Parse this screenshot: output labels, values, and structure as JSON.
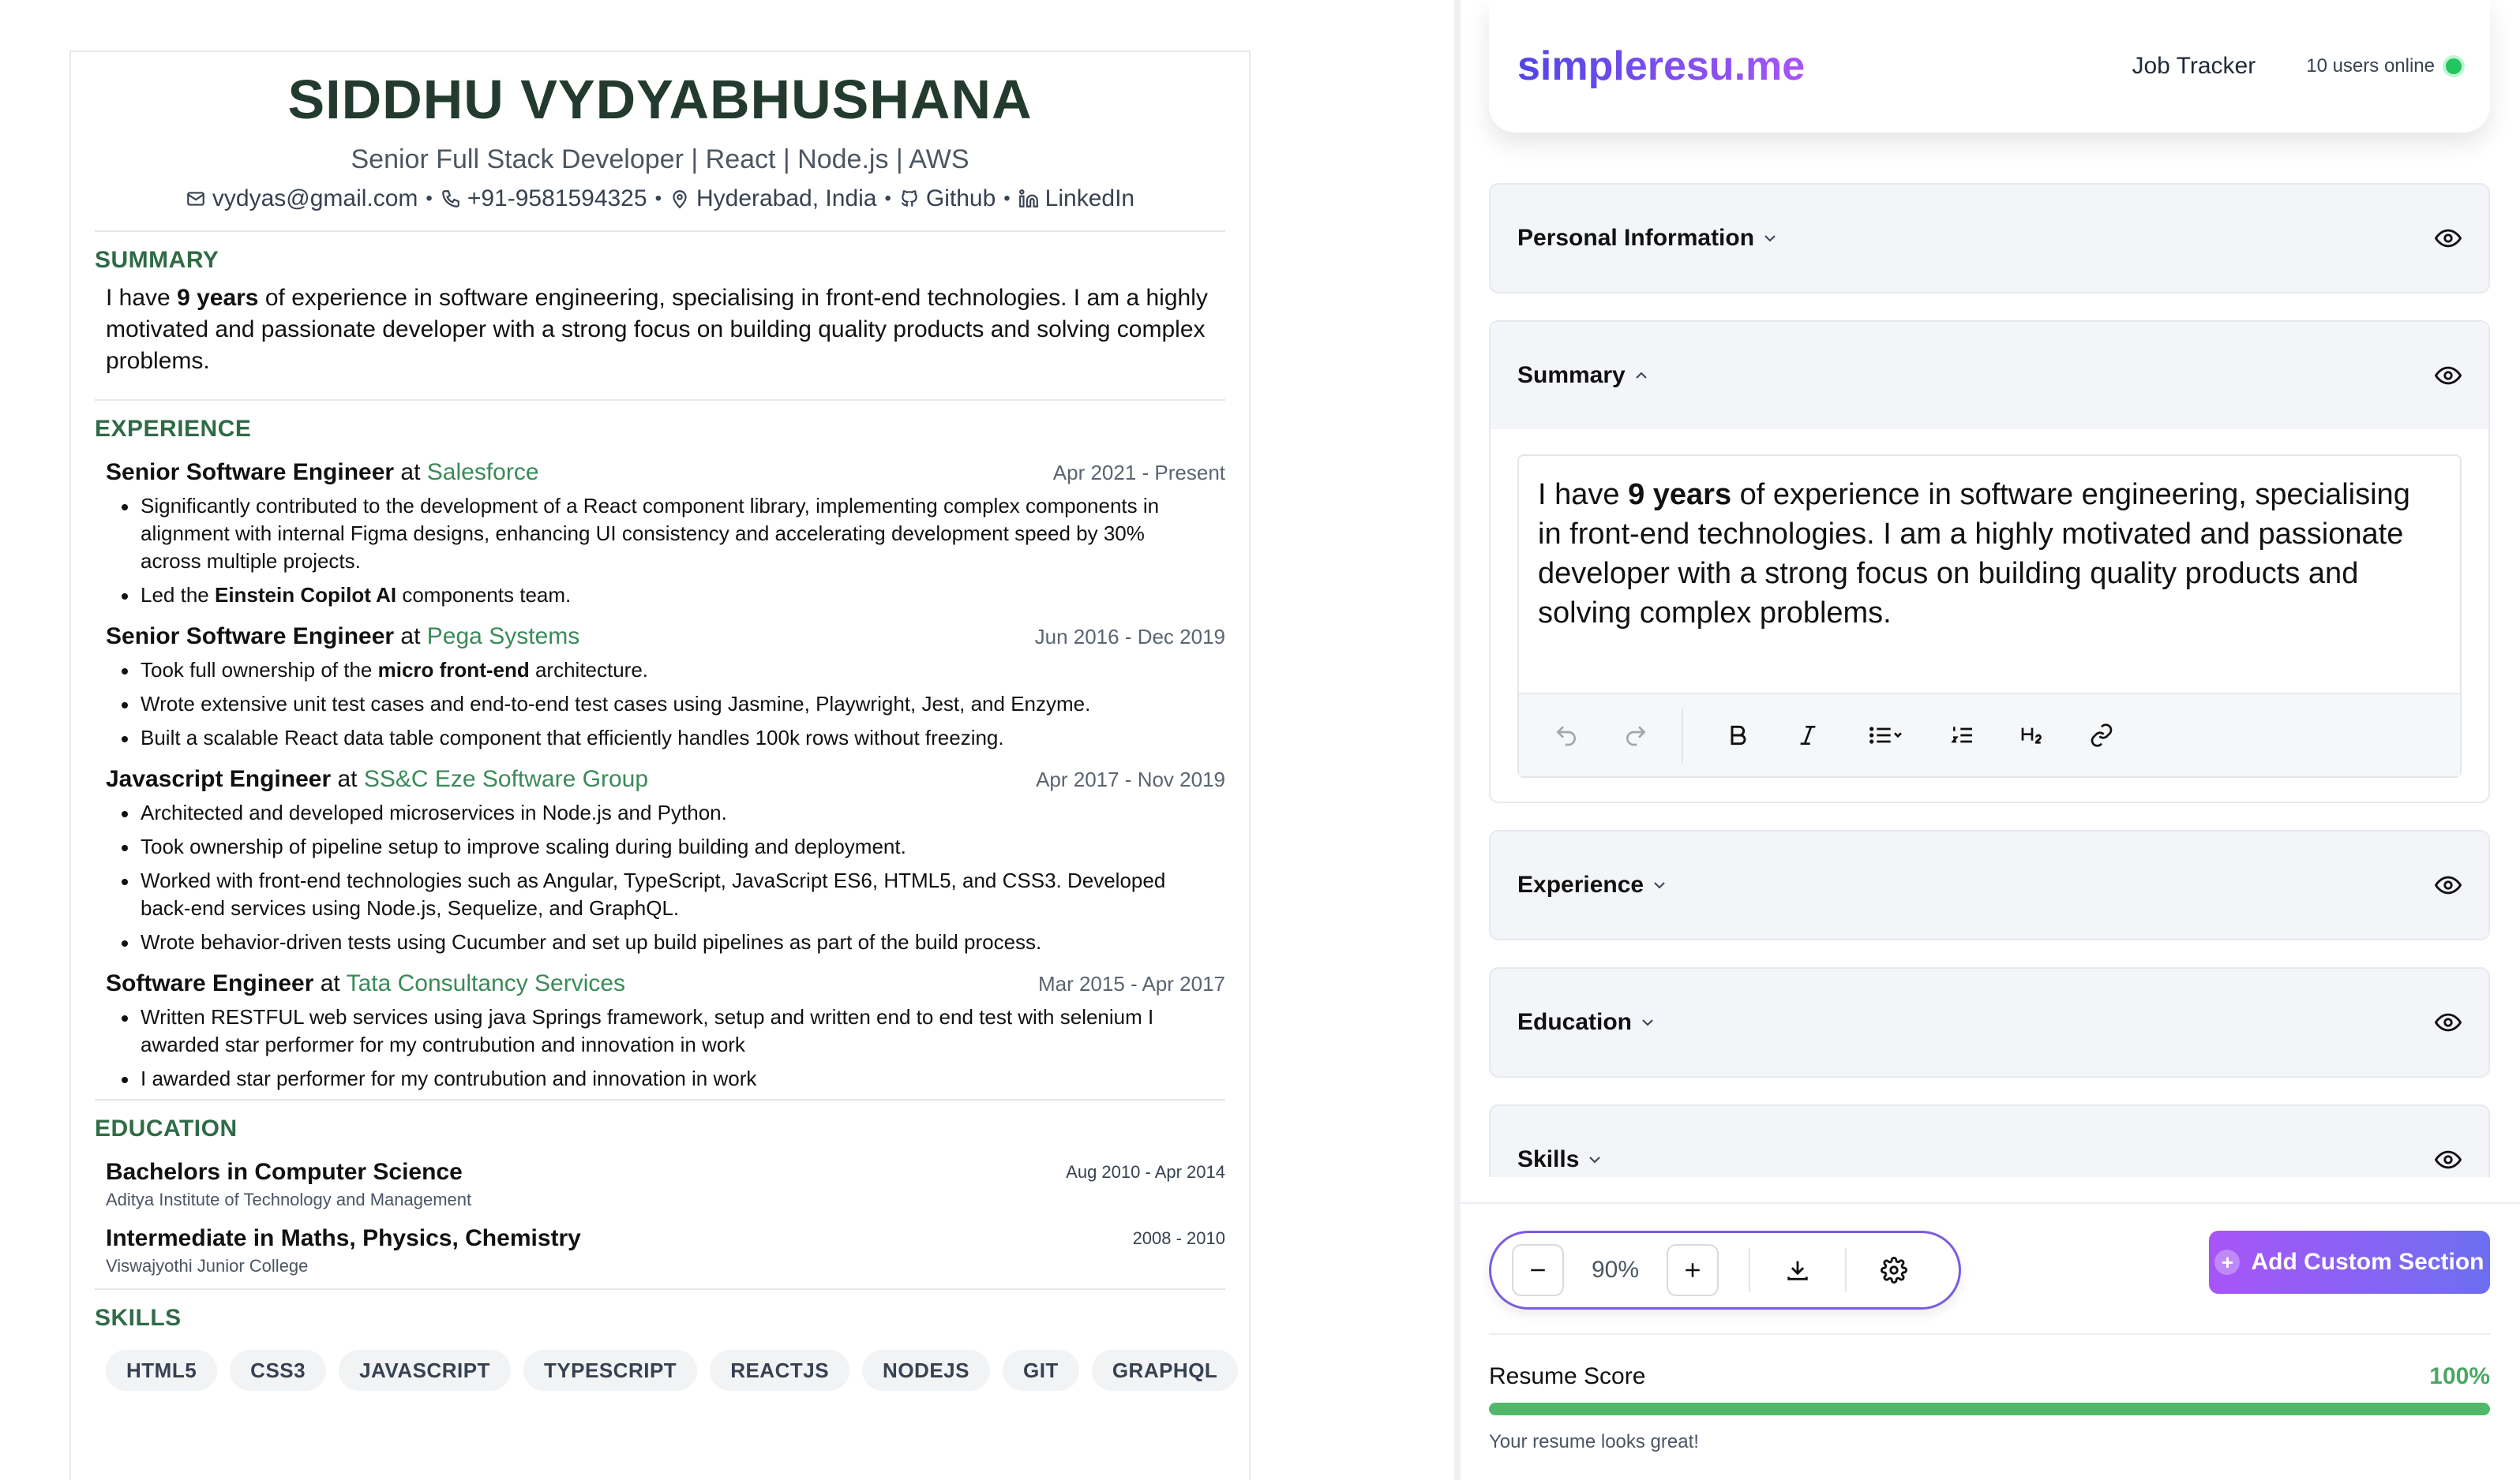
{
  "resume": {
    "name": "SIDDHU VYDYABHUSHANA",
    "headline": "Senior Full Stack Developer | React | Node.js | AWS",
    "contacts": {
      "email": "vydyas@gmail.com",
      "phone": "+91-9581594325",
      "location": "Hyderabad, India",
      "github": "Github",
      "linkedin": "LinkedIn",
      "separator": "•"
    },
    "summary": {
      "title": "SUMMARY",
      "pre": "I have ",
      "bold": "9 years",
      "post": " of experience in software engineering, specialising in front-end technologies. I am a highly motivated and passionate developer with a strong focus on building quality products and solving complex problems."
    },
    "experience": {
      "title": "EXPERIENCE",
      "at": " at ",
      "jobs": [
        {
          "role": "Senior Software Engineer",
          "company": "Salesforce",
          "dates": "Apr 2021 - Present",
          "bullets": [
            {
              "pre": "Significantly contributed to the development of a React component library, implementing complex components in alignment with internal Figma designs, enhancing UI consistency and accelerating development speed by 30% across multiple projects.",
              "bold": "",
              "post": ""
            },
            {
              "pre": "Led the ",
              "bold": "Einstein Copilot AI",
              "post": " components team."
            }
          ]
        },
        {
          "role": "Senior Software Engineer",
          "company": "Pega Systems",
          "dates": "Jun 2016 - Dec 2019",
          "bullets": [
            {
              "pre": "Took full ownership of the ",
              "bold": "micro front-end",
              "post": " architecture."
            },
            {
              "pre": "Wrote extensive unit test cases and end-to-end test cases using Jasmine, Playwright, Jest, and Enzyme.",
              "bold": "",
              "post": ""
            },
            {
              "pre": "Built a scalable React data table component that efficiently handles 100k rows without freezing.",
              "bold": "",
              "post": ""
            }
          ]
        },
        {
          "role": "Javascript Engineer",
          "company": "SS&C Eze Software Group",
          "dates": "Apr 2017 - Nov 2019",
          "bullets": [
            {
              "pre": "Architected and developed microservices in Node.js and Python.",
              "bold": "",
              "post": ""
            },
            {
              "pre": "Took ownership of pipeline setup to improve scaling during building and deployment.",
              "bold": "",
              "post": ""
            },
            {
              "pre": "Worked with front-end technologies such as Angular, TypeScript, JavaScript ES6, HTML5, and CSS3. Developed back-end services using Node.js, Sequelize, and GraphQL.",
              "bold": "",
              "post": ""
            },
            {
              "pre": "Wrote behavior-driven tests using Cucumber and set up build pipelines as part of the build process.",
              "bold": "",
              "post": ""
            }
          ]
        },
        {
          "role": "Software Engineer",
          "company": "Tata Consultancy Services",
          "dates": "Mar 2015 - Apr 2017",
          "bullets": [
            {
              "pre": "Written RESTFUL web services using java Springs framework, setup and written end to end test with selenium I awarded star performer for my contrubution and innovation in work",
              "bold": "",
              "post": ""
            },
            {
              "pre": "I awarded star performer for my contrubution and innovation in work",
              "bold": "",
              "post": ""
            }
          ]
        }
      ]
    },
    "education": {
      "title": "EDUCATION",
      "items": [
        {
          "degree": "Bachelors in Computer Science",
          "school": "Aditya Institute of Technology and Management",
          "dates": "Aug 2010 - Apr 2014"
        },
        {
          "degree": "Intermediate in Maths, Physics, Chemistry",
          "school": "Viswajyothi Junior College",
          "dates": "2008 - 2010"
        }
      ]
    },
    "skills": {
      "title": "SKILLS",
      "items": [
        "HTML5",
        "CSS3",
        "JAVASCRIPT",
        "TYPESCRIPT",
        "REACTJS",
        "NODEJS",
        "GIT",
        "GRAPHQL"
      ]
    }
  },
  "navbar": {
    "logo": "simpleresu.me",
    "job_tracker": "Job Tracker",
    "online": "10 users online"
  },
  "sections": {
    "personal": "Personal Information",
    "summary": "Summary",
    "experience": "Experience",
    "education": "Education",
    "skills": "Skills"
  },
  "editor": {
    "pre": "I have ",
    "bold": "9 years",
    "post": " of experience in software engineering, specialising in front-end technologies. I am a highly motivated and passionate developer with a strong focus on building quality products and solving complex problems."
  },
  "zoom": {
    "value": "90%"
  },
  "add_custom_section": "Add Custom Section",
  "score": {
    "label": "Resume Score",
    "value": "100%",
    "fraction": 1.0,
    "message": "Your resume looks great!"
  },
  "colors": {
    "name": "#233b2f",
    "section_title": "#2f6b46",
    "company": "#3a8a58",
    "logo_start": "#4f46e5",
    "logo_end": "#a855f7",
    "score_green": "#4fb86a",
    "online_dot": "#22c55e"
  }
}
